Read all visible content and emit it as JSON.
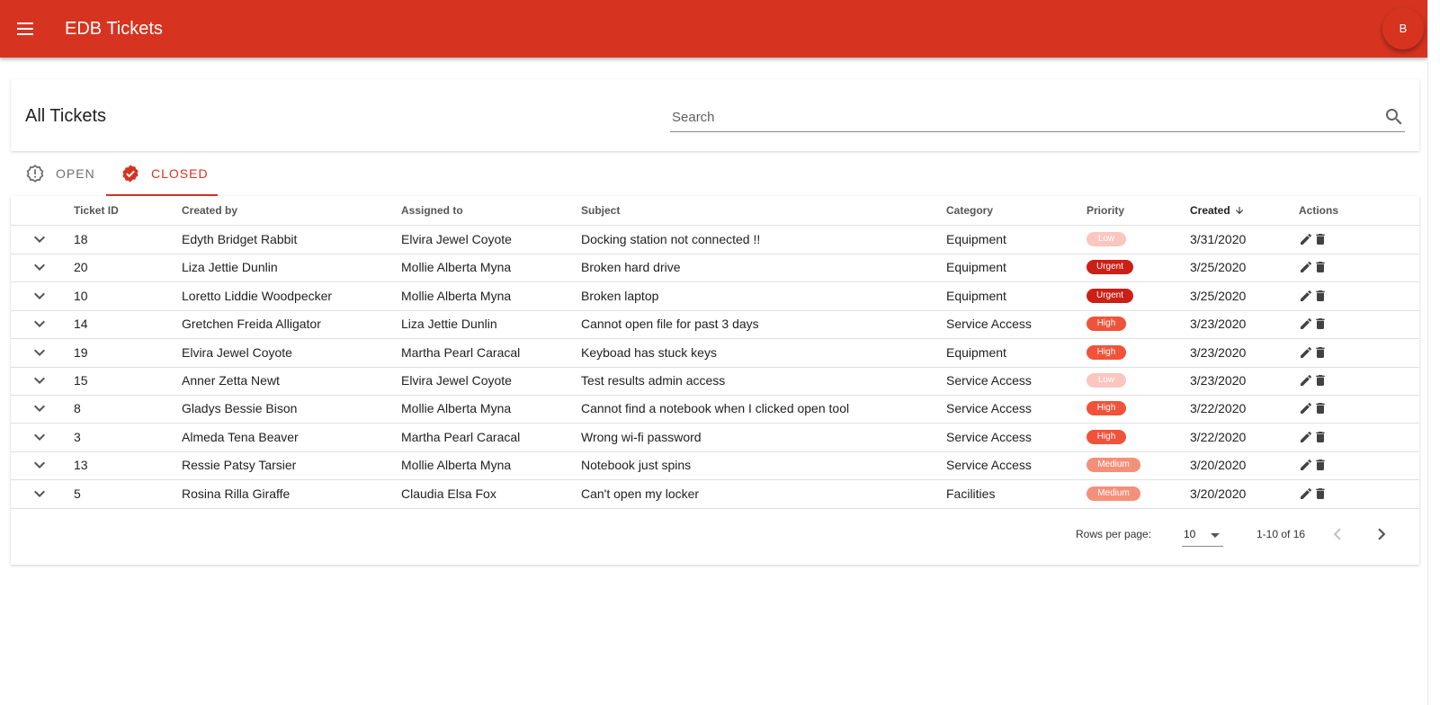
{
  "appbar": {
    "title": "EDB Tickets",
    "avatar_initial": "B"
  },
  "page": {
    "title": "All Tickets"
  },
  "search": {
    "placeholder": "Search",
    "value": ""
  },
  "tabs": [
    {
      "label": "OPEN",
      "icon": "alert-octagon-icon",
      "selected": false
    },
    {
      "label": "CLOSED",
      "icon": "verified-check-icon",
      "selected": true
    }
  ],
  "table": {
    "columns": [
      "Ticket ID",
      "Created by",
      "Assigned to",
      "Subject",
      "Category",
      "Priority",
      "Created",
      "Actions"
    ],
    "sorted_column": "Created",
    "sort_direction": "descending",
    "rows": [
      {
        "id": "18",
        "created_by": "Edyth Bridget Rabbit",
        "assigned_to": "Elvira Jewel Coyote",
        "subject": "Docking station not connected !!",
        "category": "Equipment",
        "priority": "Low",
        "created": "3/31/2020"
      },
      {
        "id": "20",
        "created_by": "Liza Jettie Dunlin",
        "assigned_to": "Mollie Alberta Myna",
        "subject": "Broken hard drive",
        "category": "Equipment",
        "priority": "Urgent",
        "created": "3/25/2020"
      },
      {
        "id": "10",
        "created_by": "Loretto Liddie Woodpecker",
        "assigned_to": "Mollie Alberta Myna",
        "subject": "Broken laptop",
        "category": "Equipment",
        "priority": "Urgent",
        "created": "3/25/2020"
      },
      {
        "id": "14",
        "created_by": "Gretchen Freida Alligator",
        "assigned_to": "Liza Jettie Dunlin",
        "subject": "Cannot open file for past 3 days",
        "category": "Service Access",
        "priority": "High",
        "created": "3/23/2020"
      },
      {
        "id": "19",
        "created_by": "Elvira Jewel Coyote",
        "assigned_to": "Martha Pearl Caracal",
        "subject": "Keyboad has stuck keys",
        "category": "Equipment",
        "priority": "High",
        "created": "3/23/2020"
      },
      {
        "id": "15",
        "created_by": "Anner Zetta Newt",
        "assigned_to": "Elvira Jewel Coyote",
        "subject": "Test results admin access",
        "category": "Service Access",
        "priority": "Low",
        "created": "3/23/2020"
      },
      {
        "id": "8",
        "created_by": "Gladys Bessie Bison",
        "assigned_to": "Mollie Alberta Myna",
        "subject": "Cannot find a notebook when I clicked open tool",
        "category": "Service Access",
        "priority": "High",
        "created": "3/22/2020"
      },
      {
        "id": "3",
        "created_by": "Almeda Tena Beaver",
        "assigned_to": "Martha Pearl Caracal",
        "subject": "Wrong wi-fi password",
        "category": "Service Access",
        "priority": "High",
        "created": "3/22/2020"
      },
      {
        "id": "13",
        "created_by": "Ressie Patsy Tarsier",
        "assigned_to": "Mollie Alberta Myna",
        "subject": "Notebook just spins",
        "category": "Service Access",
        "priority": "Medium",
        "created": "3/20/2020"
      },
      {
        "id": "5",
        "created_by": "Rosina Rilla Giraffe",
        "assigned_to": "Claudia Elsa Fox",
        "subject": "Can't open my locker",
        "category": "Facilities",
        "priority": "Medium",
        "created": "3/20/2020"
      }
    ]
  },
  "pagination": {
    "rows_per_page_label": "Rows per page:",
    "rows_per_page": "10",
    "range": "1-10 of 16"
  },
  "colors": {
    "brand": "#d63420",
    "priority_low": "#fbc6bf",
    "priority_urgent": "#cc1f16",
    "priority_high": "#f0533a",
    "priority_medium": "#f4907a"
  }
}
